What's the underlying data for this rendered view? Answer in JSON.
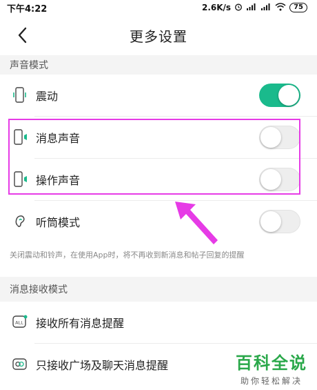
{
  "status_bar": {
    "time": "下午4:22",
    "speed": "2.6K/s",
    "battery": "75"
  },
  "header": {
    "title": "更多设置"
  },
  "sound_section": {
    "title": "声音模式",
    "items": [
      {
        "label": "震动",
        "state": "on"
      },
      {
        "label": "消息声音",
        "state": "off"
      },
      {
        "label": "操作声音",
        "state": "off"
      },
      {
        "label": "听筒模式",
        "state": "off"
      }
    ],
    "note": "关闭震动和铃声，在使用App时，将不再收到新消息和帖子回复的提醒"
  },
  "receive_section": {
    "title": "消息接收模式",
    "items": [
      {
        "label": "接收所有消息提醒",
        "icon_text": "ALL"
      },
      {
        "label": "只接收广场及聊天消息提醒"
      }
    ]
  },
  "watermark": {
    "main": "百科全说",
    "sub": "助你轻松解决"
  },
  "colors": {
    "accent": "#1aba8c",
    "highlight": "#e63be6",
    "watermark": "#2aa84a"
  }
}
